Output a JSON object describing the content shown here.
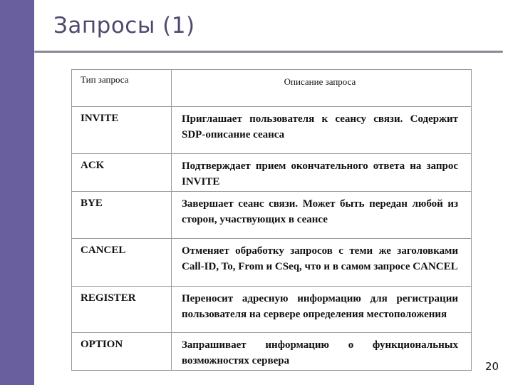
{
  "slide": {
    "title": "Запросы (1)",
    "page_number": "20",
    "accent_color": "#6a5f9e"
  },
  "table": {
    "headers": [
      "Тип запроса",
      "Описание запроса"
    ],
    "rows": [
      {
        "type": "INVITE",
        "description": "Приглашает пользователя к сеансу связи. Содержит SDP-описание сеанса"
      },
      {
        "type": "ACK",
        "description": "Подтверждает прием окончательного ответа на запрос INVITE"
      },
      {
        "type": "BYE",
        "description": "Завершает сеанс связи. Может быть передан любой из сторон, участвующих в сеансе"
      },
      {
        "type": "CANCEL",
        "description": "Отменяет обработку запросов с теми же заголовками Call-ID, To, From и CSeq, что и в самом запросе CANCEL"
      },
      {
        "type": "REGISTER",
        "description": "Переносит адресную информацию для регистрации пользователя на сервере определения местоположения"
      },
      {
        "type": "OPTION",
        "description": "Запрашивает информацию о функциональных возможностях сервера"
      }
    ]
  }
}
